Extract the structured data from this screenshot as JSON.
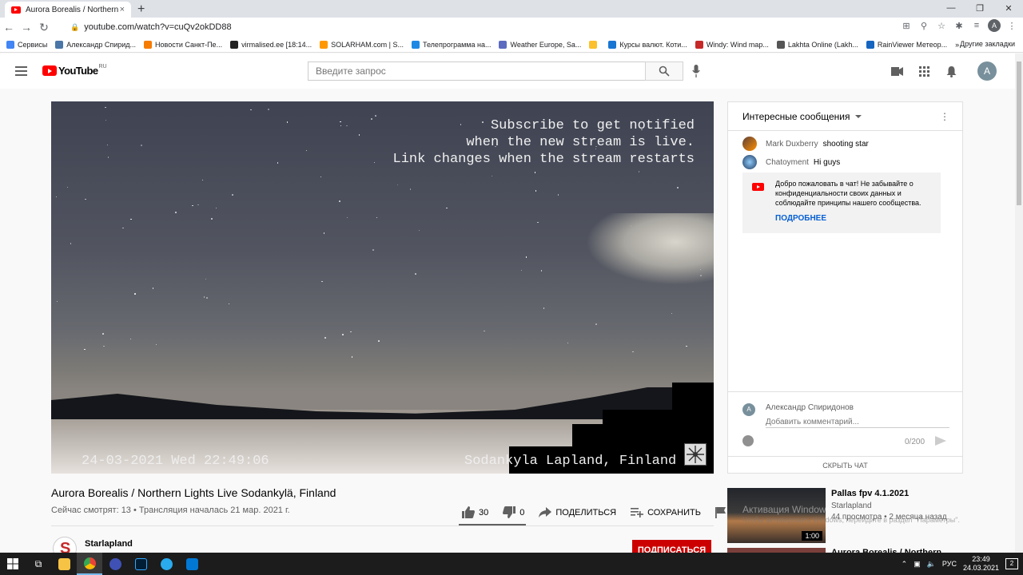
{
  "browser": {
    "tab_title": "Aurora Borealis / Northern Lights",
    "tab_close": "×",
    "new_tab": "+",
    "url": "youtube.com/watch?v=cuQv2okDD88",
    "bookmarks": [
      {
        "label": "Сервисы",
        "color": "#4285f4"
      },
      {
        "label": "Александр Спирид...",
        "color": "#4a76a8"
      },
      {
        "label": "Новости Санкт-Пе...",
        "color": "#f57c00"
      },
      {
        "label": "virmalised.ee [18:14...",
        "color": "#222222"
      },
      {
        "label": "SOLARHAM.com | S...",
        "color": "#ff9800"
      },
      {
        "label": "Телепрограмма на...",
        "color": "#1e88e5"
      },
      {
        "label": "Weather Europe, Sa...",
        "color": "#5c6bc0"
      },
      {
        "label": "",
        "color": "#fbc02d"
      },
      {
        "label": "Курсы валют. Коти...",
        "color": "#1976d2"
      },
      {
        "label": "Windy: Wind map...",
        "color": "#c62828"
      },
      {
        "label": "Lakhta Online (Lakh...",
        "color": "#555555"
      },
      {
        "label": "RainViewer Метеор...",
        "color": "#1565c0"
      }
    ],
    "more_bookmarks": "»",
    "other_bookmarks": "Другие закладки",
    "profile_initial": "A"
  },
  "header": {
    "logo_text": "YouTube",
    "logo_region": "RU",
    "search_placeholder": "Введите запрос",
    "avatar_initial": "A"
  },
  "video": {
    "overlay_text": "Subscribe to get notified\nwhen the new stream is live.\nLink changes when the stream restarts",
    "timestamp": "24-03-2021 Wed 22:49:06",
    "location": "Sodankyla Lapland, Finland",
    "title": "Aurora Borealis / Northern Lights Live Sodankylä, Finland",
    "meta": "Сейчас смотрят: 13 • Трансляция началась 21 мар. 2021 г.",
    "likes": "30",
    "dislikes": "0",
    "like_ratio": 1.0,
    "share_label": "ПОДЕЛИТЬСЯ",
    "save_label": "СОХРАНИТЬ"
  },
  "channel": {
    "name": "Starlapland",
    "subscribe_label": "ПОДПИСАТЬСЯ"
  },
  "chat": {
    "header": "Интересные сообщения",
    "messages": [
      {
        "author": "Mark Duxberry",
        "text": "shooting star"
      },
      {
        "author": "Chatoyment",
        "text": "Hi guys"
      }
    ],
    "welcome_text": "Добро пожаловать в чат! Не забывайте о конфиденциальности своих данных и соблюдайте принципы нашего сообщества.",
    "learn_more": "ПОДРОБНЕЕ",
    "input_author": "Александр Спиридонов",
    "input_placeholder": "Добавить комментарий...",
    "input_initial": "A",
    "char_count": "0/200",
    "hide_chat": "СКРЫТЬ ЧАТ"
  },
  "recommendations": [
    {
      "title": "Pallas fpv 4.1.2021",
      "channel": "Starlapland",
      "meta": "44 просмотра • 2 месяца назад",
      "duration": "1:00"
    },
    {
      "title": "Aurora Borealis / Northern"
    }
  ],
  "watermark": {
    "line1": "Активация Windows",
    "line2": "Чтобы активировать Windows, перейдите в раздел \"Параметры\"."
  },
  "taskbar": {
    "lang": "РУС",
    "time": "23:49",
    "date": "24.03.2021",
    "notifications": "2"
  }
}
